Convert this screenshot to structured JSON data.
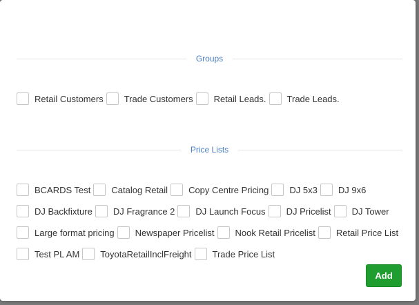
{
  "groups": {
    "title": "Groups",
    "items": [
      "Retail Customers",
      "Trade Customers",
      "Retail Leads.",
      "Trade Leads."
    ]
  },
  "price_lists": {
    "title": "Price Lists",
    "rows": [
      [
        "BCARDS Test",
        "Catalog Retail",
        "Copy Centre Pricing",
        "DJ 5x3",
        "DJ 9x6"
      ],
      [
        "DJ Backfixture",
        "DJ Fragrance 2",
        "DJ Launch Focus",
        "DJ Pricelist",
        "DJ Tower"
      ],
      [
        "Large format pricing",
        "Newspaper Pricelist",
        "Nook Retail Pricelist",
        "Retail Price List"
      ],
      [
        "Test PL AM",
        "ToyotaRetailInclFreight",
        "Trade Price List"
      ]
    ]
  },
  "actions": {
    "add_label": "Add"
  }
}
